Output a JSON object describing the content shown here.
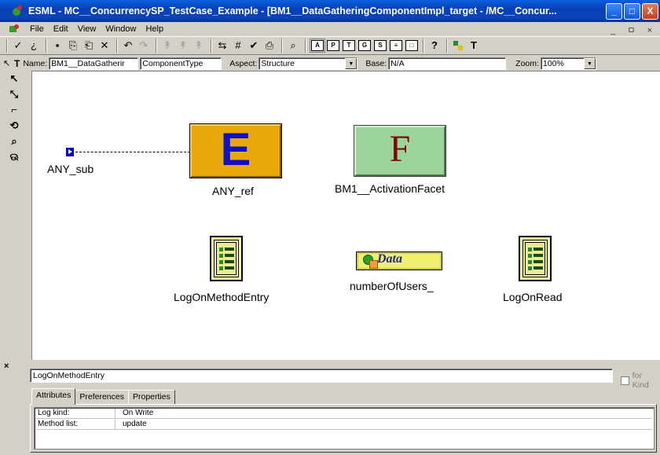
{
  "window": {
    "title": "ESML - MC__ConcurrencySP_TestCase_Example - [BM1__DataGatheringComponentImpl_target - /MC__Concur...",
    "buttons": {
      "minimize": "_",
      "maximize": "□",
      "close": "X"
    }
  },
  "menu": {
    "items": [
      "File",
      "Edit",
      "View",
      "Window",
      "Help"
    ],
    "mdi_controls": "_ ㅁ ×"
  },
  "toolbar": {
    "glyphs": [
      "✓",
      "¿",
      "▪",
      "⎘",
      "⎗",
      "✕",
      "↶",
      "↷",
      "↟",
      "↟",
      "↟",
      "⇆",
      "#",
      "✔",
      "⎙",
      "⌕",
      "A",
      "P",
      "T",
      "G",
      "S",
      "≡",
      "□",
      "?",
      "T"
    ],
    "icons": [
      "check-icon",
      "help-cursor-icon",
      "save-icon",
      "copy-icon",
      "paste-icon",
      "delete-icon",
      "undo-icon",
      "redo-icon",
      "up-icon",
      "up-icon",
      "up-icon",
      "connect-icon",
      "grid-icon",
      "validate-icon",
      "print-icon",
      "find-icon"
    ]
  },
  "properties": {
    "name_label": "Name:",
    "name_value": "BM1__DataGatherir",
    "kind_value": "ComponentType",
    "aspect_label": "Aspect:",
    "aspect_value": "Structure",
    "base_label": "Base:",
    "base_value": "N/A",
    "zoom_label": "Zoom:",
    "zoom_value": "100%"
  },
  "palette": {
    "tools": [
      "select-tool",
      "zoom-area-tool",
      "connect-tool",
      "disconnect-tool",
      "zoom-tool",
      "visualize-tool"
    ],
    "glyphs": [
      "↖",
      "⤡",
      "⌐",
      "⟲",
      "⌕",
      "ଊ"
    ]
  },
  "canvas": {
    "nodes": {
      "any_sub": "ANY_sub",
      "any_ref": "ANY_ref",
      "any_ref_glyph": "E",
      "activation_facet": "BM1__ActivationFacet",
      "activation_facet_glyph": "F",
      "log_method_entry": "LogOnMethodEntry",
      "number_of_users": "numberOfUsers_",
      "data_word": "Data",
      "log_on_read": "LogOnRead"
    }
  },
  "inspector": {
    "close_glyph": "×",
    "object_name": "LogOnMethodEntry",
    "for_kind_label": "for Kind",
    "tabs": [
      "Attributes",
      "Preferences",
      "Properties"
    ],
    "active_tab": "Attributes",
    "attributes": [
      {
        "key": "Log kind:",
        "value": "On Write"
      },
      {
        "key": "Method list:",
        "value": "update"
      }
    ]
  }
}
